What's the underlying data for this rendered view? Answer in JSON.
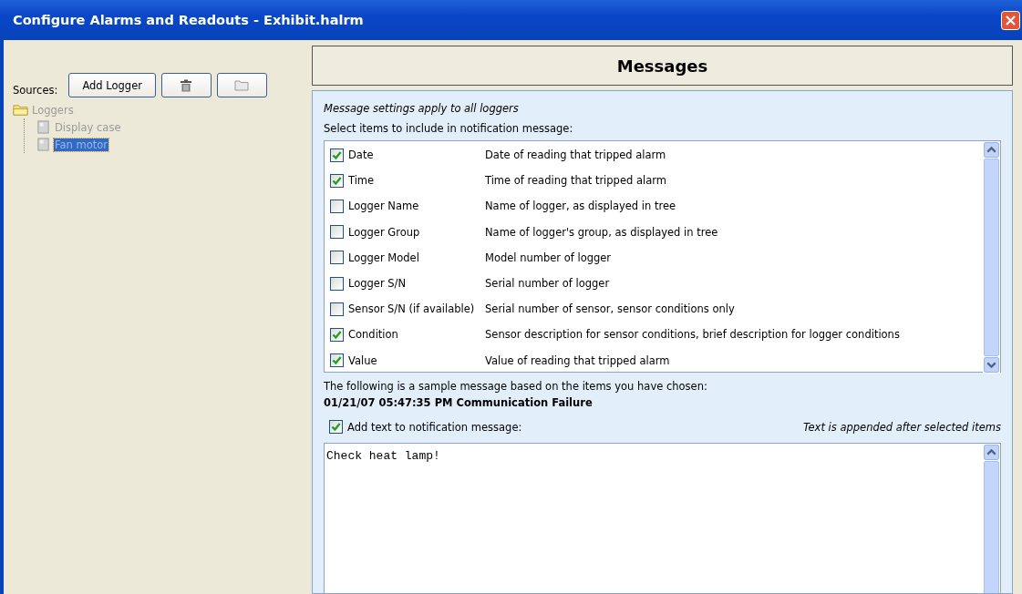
{
  "window": {
    "title": "Configure Alarms and Readouts - Exhibit.halrm"
  },
  "sources": {
    "label": "Sources:",
    "add_button": "Add Logger"
  },
  "tree": [
    {
      "label": "Loggers",
      "selected": false,
      "children": [
        {
          "label": "Display case",
          "selected": false
        },
        {
          "label": "Fan motor",
          "selected": true
        }
      ]
    }
  ],
  "messages": {
    "title": "Messages",
    "note": "Message settings apply to all loggers",
    "prompt": "Select items to include in notification message:",
    "items": [
      {
        "label": "Date",
        "description": "Date of reading that tripped alarm",
        "checked": true
      },
      {
        "label": "Time",
        "description": "Time of reading that tripped alarm",
        "checked": true
      },
      {
        "label": "Logger Name",
        "description": "Name of logger, as displayed in tree",
        "checked": false
      },
      {
        "label": "Logger Group",
        "description": "Name of logger's group, as displayed in tree",
        "checked": false
      },
      {
        "label": "Logger Model",
        "description": "Model number of logger",
        "checked": false
      },
      {
        "label": "Logger S/N",
        "description": "Serial number of logger",
        "checked": false
      },
      {
        "label": "Sensor S/N (if available)",
        "description": "Serial number of sensor, sensor conditions only",
        "checked": false
      },
      {
        "label": "Condition",
        "description": "Sensor description for sensor conditions, brief description for logger conditions",
        "checked": true
      },
      {
        "label": "Value",
        "description": "Value of reading that tripped alarm",
        "checked": true
      }
    ],
    "sample_intro": "The following is a sample message based on the items you have chosen:",
    "sample": "01/21/07 05:47:35 PM Communication Failure",
    "add_text": {
      "label": "Add text to notification message:",
      "checked": true,
      "hint": "Text is appended after selected items",
      "value": "Check heat lamp!"
    }
  }
}
